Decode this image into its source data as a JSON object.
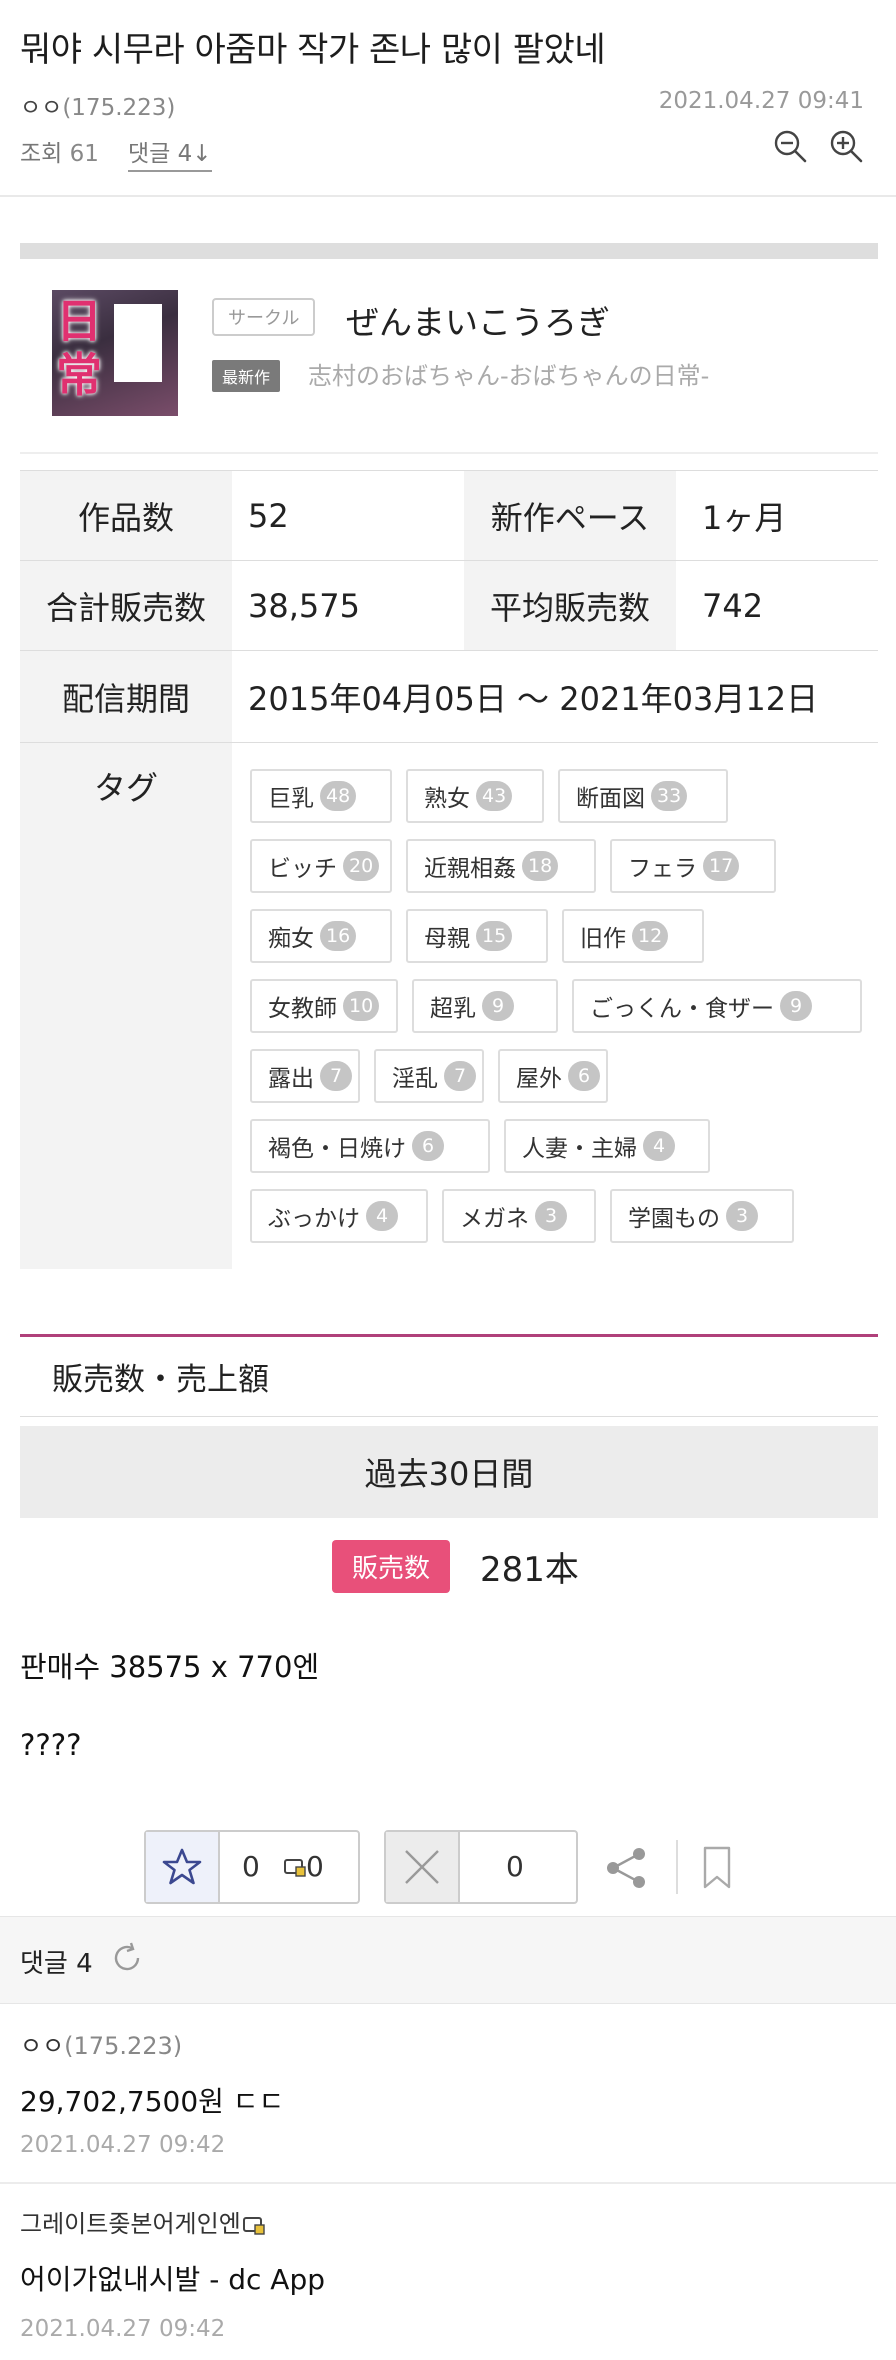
{
  "post": {
    "title": "뭐야 시무라 아줌마 작가 존나 많이 팔았네",
    "author_name": "ㅇㅇ",
    "author_ip": "(175.223)",
    "date": "2021.04.27 09:41",
    "views_label": "조회",
    "views": "61",
    "comments_link": "댓글 4",
    "comments_arrow": "↓",
    "zoom_out_icon": "zoom-out-icon",
    "zoom_in_icon": "zoom-in-icon"
  },
  "embed": {
    "thumb_text": "日常",
    "circle_badge": "サークル",
    "circle_name": "ぜんまいこうろぎ",
    "new_badge": "最新作",
    "new_title": "志村のおばちゃん-おばちゃんの日常-",
    "stats": {
      "works_label": "作品数",
      "works_value": "52",
      "pace_label": "新作ペース",
      "pace_value": "1ヶ月",
      "total_sales_label": "合計販売数",
      "total_sales_value": "38,575",
      "avg_sales_label": "平均販売数",
      "avg_sales_value": "742",
      "period_label": "配信期間",
      "period_value": "2015年04月05日 ～ 2021年03月12日",
      "tags_label": "タグ"
    },
    "tags": [
      {
        "name": "巨乳",
        "count": "48"
      },
      {
        "name": "熟女",
        "count": "43"
      },
      {
        "name": "断面図",
        "count": "33"
      },
      {
        "name": "ビッチ",
        "count": "20"
      },
      {
        "name": "近親相姦",
        "count": "18"
      },
      {
        "name": "フェラ",
        "count": "17"
      },
      {
        "name": "痴女",
        "count": "16"
      },
      {
        "name": "母親",
        "count": "15"
      },
      {
        "name": "旧作",
        "count": "12"
      },
      {
        "name": "女教師",
        "count": "10"
      },
      {
        "name": "超乳",
        "count": "9"
      },
      {
        "name": "ごっくん・食ザー",
        "count": "9"
      },
      {
        "name": "露出",
        "count": "7"
      },
      {
        "name": "淫乱",
        "count": "7"
      },
      {
        "name": "屋外",
        "count": "6"
      },
      {
        "name": "褐色・日焼け",
        "count": "6"
      },
      {
        "name": "人妻・主婦",
        "count": "4"
      },
      {
        "name": "ぶっかけ",
        "count": "4"
      },
      {
        "name": "メガネ",
        "count": "3"
      },
      {
        "name": "学園もの",
        "count": "3"
      }
    ],
    "sales_header": "販売数・売上額",
    "period_tab": "過去30日間",
    "sales_badge": "販売数",
    "sales_value": "281本"
  },
  "body": {
    "line1": "판매수 38575 x 770엔",
    "line2": "????"
  },
  "reactions": {
    "recommend_count": "0",
    "fix_recommend_count": "0",
    "nonrecommend_count": "0",
    "accent": "#3b4890"
  },
  "comments": {
    "header": "댓글 4",
    "items": [
      {
        "author": "ㅇㅇ",
        "ip": "(175.223)",
        "text": "29,702,7500원 ㄷㄷ",
        "date": "2021.04.27 09:42"
      },
      {
        "author": "그레이트좆본어게인엔",
        "ip": "",
        "text": "어이가없내시발 - dc App",
        "date": "2021.04.27 09:42"
      }
    ]
  }
}
